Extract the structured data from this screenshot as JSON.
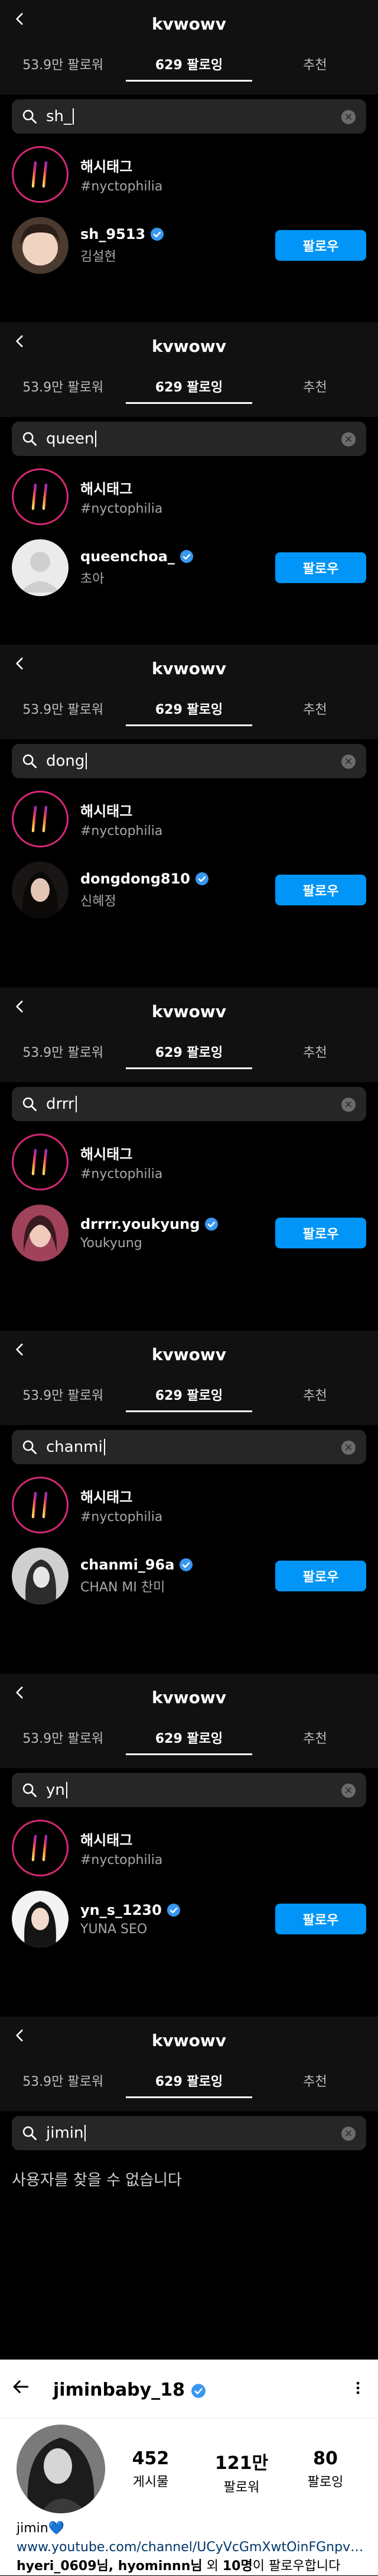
{
  "header": {
    "account": "kvwowv"
  },
  "tabs": {
    "followers": "53.9만 팔로워",
    "following": "629 팔로잉",
    "recommend": "추천"
  },
  "hashtag": {
    "title": "해시태그",
    "tag": "#nyctophilia"
  },
  "follow_label": "팔로우",
  "screens": [
    {
      "query": "sh_",
      "user": {
        "username": "sh_9513",
        "name": "김설현"
      }
    },
    {
      "query": "queen",
      "user": {
        "username": "queenchoa_",
        "name": "초아"
      }
    },
    {
      "query": "dong",
      "user": {
        "username": "dongdong810",
        "name": "신혜정"
      }
    },
    {
      "query": "drrr",
      "user": {
        "username": "drrrr.youkyung",
        "name": "Youkyung"
      }
    },
    {
      "query": "chanmi",
      "user": {
        "username": "chanmi_96a",
        "name": "CHAN MI 찬미"
      }
    },
    {
      "query": "yn",
      "user": {
        "username": "yn_s_1230",
        "name": "YUNA SEO"
      }
    },
    {
      "query": "jimin",
      "empty_message": "사용자를 찾을 수 없습니다"
    }
  ],
  "profile": {
    "username": "jiminbaby_18",
    "stats": [
      {
        "value": "452",
        "label": "게시물"
      },
      {
        "value": "121만",
        "label": "팔로워"
      },
      {
        "value": "80",
        "label": "팔로잉"
      }
    ],
    "bio_name": "jimin💙",
    "link": "www.youtube.com/channel/UCyVcGmXwtOinFGnpv82c...",
    "followed_by_users": "hyeri_0609님, hyominnn님",
    "followed_by_mid": " 외 ",
    "followed_by_count": "10명",
    "followed_by_tail": "이 팔로우합니다"
  },
  "colors": {
    "follow_blue": "#0095f6",
    "verified": "#3897f0",
    "hashtag_ring": "#d62976"
  }
}
